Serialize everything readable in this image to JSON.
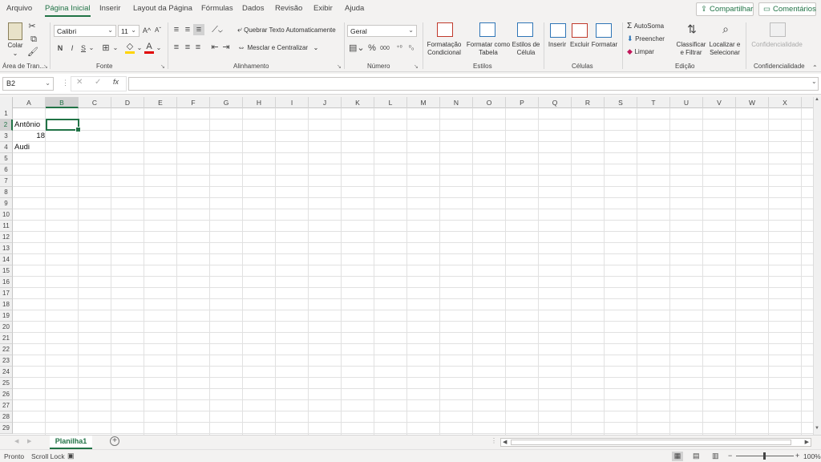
{
  "tabs": [
    "Arquivo",
    "Página Inicial",
    "Inserir",
    "Layout da Página",
    "Fórmulas",
    "Dados",
    "Revisão",
    "Exibir",
    "Ajuda"
  ],
  "active_tab": "Página Inicial",
  "share_label": "Compartilhar",
  "comments_label": "Comentários",
  "ribbon": {
    "clipboard": {
      "paste": "Colar",
      "group": "Área de Tran..."
    },
    "font": {
      "name": "Calibri",
      "size": "11",
      "bold": "N",
      "italic": "I",
      "underline": "S",
      "grow": "A^",
      "shrink": "Aˇ",
      "group": "Fonte"
    },
    "alignment": {
      "wrap": "Quebrar Texto Automaticamente",
      "merge": "Mesclar e Centralizar",
      "group": "Alinhamento"
    },
    "number": {
      "format": "Geral",
      "percent": "%",
      "thousands": "000",
      "inc_decimal": ",00→,0",
      "group": "Número"
    },
    "styles": {
      "conditional": [
        "Formatação",
        "Condicional"
      ],
      "table": [
        "Formatar como",
        "Tabela"
      ],
      "cell": [
        "Estilos de",
        "Célula"
      ],
      "group": "Estilos"
    },
    "cells": {
      "insert": "Inserir",
      "delete": "Excluir",
      "format": "Formatar",
      "group": "Células"
    },
    "editing": {
      "autosum": "AutoSoma",
      "fill": "Preencher",
      "clear": "Limpar",
      "sort": [
        "Classificar",
        "e Filtrar"
      ],
      "find": [
        "Localizar e",
        "Selecionar"
      ],
      "group": "Edição"
    },
    "sensitivity": {
      "label": "Confidencialidade",
      "group": "Confidencialidade"
    }
  },
  "formula_bar": {
    "name_box": "B2",
    "fx": "fx",
    "content": ""
  },
  "columns": [
    "A",
    "B",
    "C",
    "D",
    "E",
    "F",
    "G",
    "H",
    "I",
    "J",
    "K",
    "L",
    "M",
    "N",
    "O",
    "P",
    "Q",
    "R",
    "S",
    "T",
    "U",
    "V",
    "W",
    "X"
  ],
  "rows": [
    "1",
    "2",
    "3",
    "4",
    "5",
    "6",
    "7",
    "8",
    "9",
    "10",
    "11",
    "12",
    "13",
    "14",
    "15",
    "16",
    "17",
    "18",
    "19",
    "20",
    "21",
    "22",
    "23",
    "24",
    "25",
    "26",
    "27",
    "28",
    "29"
  ],
  "selected_cell": "B2",
  "cells": {
    "A2": "Antônio",
    "A3": "18",
    "A4": "Audi"
  },
  "sheet_tab": "Planilha1",
  "status": {
    "ready": "Pronto",
    "scroll_lock": "Scroll Lock",
    "zoom": "100%"
  }
}
